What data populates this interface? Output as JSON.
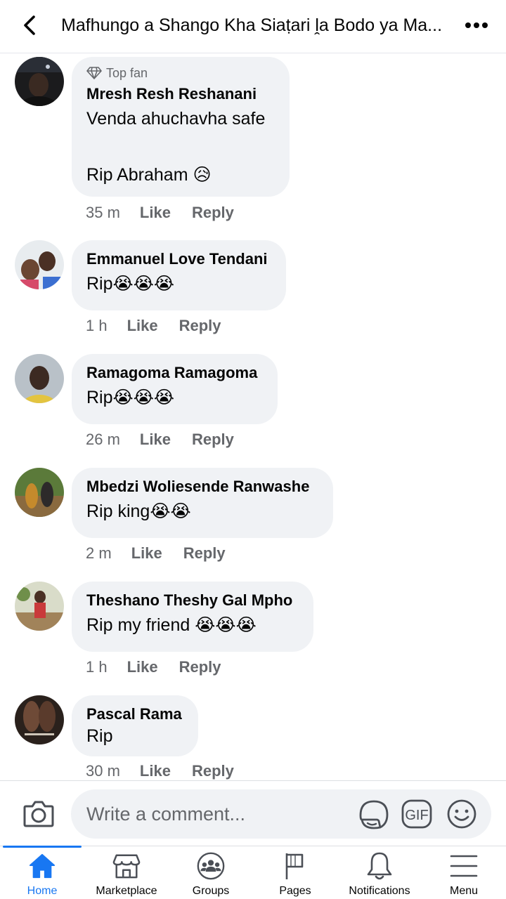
{
  "header": {
    "back_icon": "chevron-left-icon",
    "title": "Mafhungo a Shango Kha Siaṭari ḽa Bodo ya Ma...",
    "more_icon": "more-horizontal-icon"
  },
  "comments": [
    {
      "badge": "Top fan",
      "badge_icon": "diamond-icon",
      "author": "Mresh Resh Reshanani",
      "text": "Venda ahuchavha safe\n\nRip Abraham 😥",
      "time": "35 m",
      "like": "Like",
      "reply": "Reply"
    },
    {
      "author": "Emmanuel Love Tendani",
      "text": "Rip😭😭😭",
      "time": "1 h",
      "like": "Like",
      "reply": "Reply"
    },
    {
      "author": "Ramagoma Ramagoma",
      "text": "Rip😭😭😭",
      "time": "26 m",
      "like": "Like",
      "reply": "Reply"
    },
    {
      "author": "Mbedzi Woliesende Ranwashe",
      "text": "Rip king😭😭",
      "time": "2 m",
      "like": "Like",
      "reply": "Reply"
    },
    {
      "author": "Theshano Theshy Gal Mpho",
      "text": "Rip my friend 😭😭😭",
      "time": "1 h",
      "like": "Like",
      "reply": "Reply"
    },
    {
      "author": "Pascal Rama",
      "text": "Rip",
      "time": "30 m",
      "like": "Like",
      "reply": "Reply"
    }
  ],
  "composer": {
    "placeholder": "Write a comment...",
    "camera_icon": "camera-icon",
    "sticker_icon": "sticker-icon",
    "gif_label": "GIF",
    "emoji_icon": "emoji-icon"
  },
  "bottom_nav": {
    "active": "Home",
    "items": [
      {
        "label": "Home",
        "icon": "home-icon"
      },
      {
        "label": "Marketplace",
        "icon": "marketplace-icon"
      },
      {
        "label": "Groups",
        "icon": "groups-icon"
      },
      {
        "label": "Pages",
        "icon": "flag-icon"
      },
      {
        "label": "Notifications",
        "icon": "bell-icon"
      },
      {
        "label": "Menu",
        "icon": "hamburger-menu-icon"
      }
    ]
  },
  "colors": {
    "accent": "#1877f2",
    "bubble": "#f0f2f5",
    "secondary_text": "#65676b",
    "primary_text": "#050505"
  }
}
